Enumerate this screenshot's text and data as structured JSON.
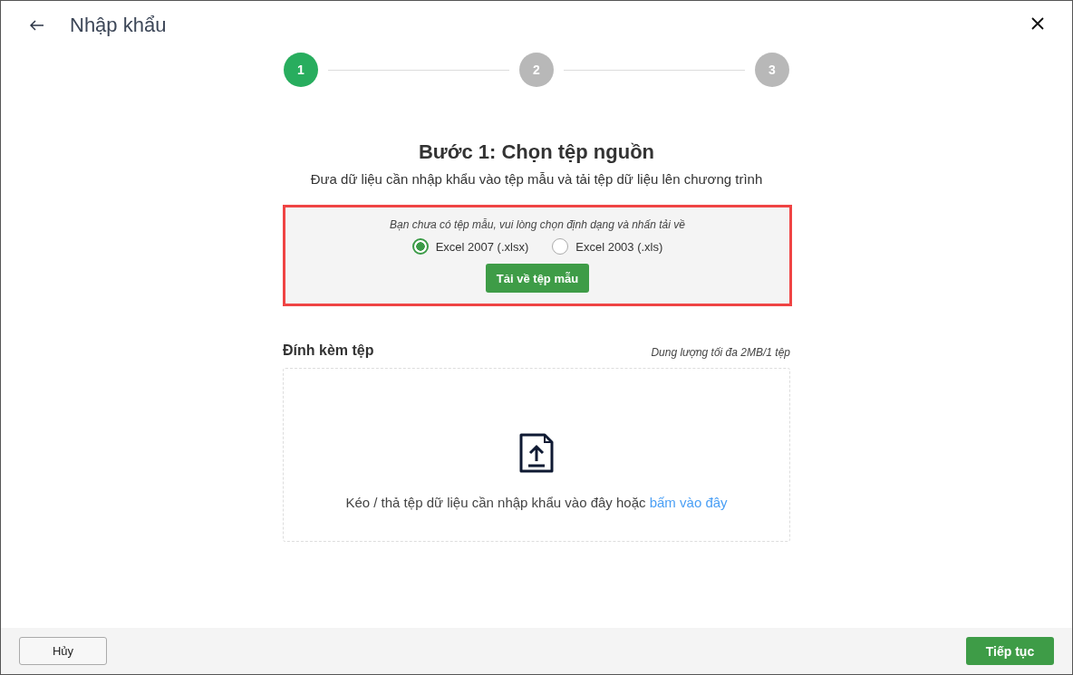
{
  "window": {
    "title": "Nhập khẩu"
  },
  "steps": [
    {
      "label": "1",
      "selected": true
    },
    {
      "label": "2",
      "selected": false
    },
    {
      "label": "3",
      "selected": false
    }
  ],
  "heading": "Bước 1: Chọn tệp nguồn",
  "subtitle": "Đưa dữ liệu cần nhập khẩu vào tệp mẫu và tải tệp dữ liệu lên chương trình",
  "template": {
    "hint": "Bạn chưa có tệp mẫu, vui lòng chọn định dạng và nhấn tải về",
    "formats": [
      {
        "label": "Excel 2007 (.xlsx)",
        "selected": true
      },
      {
        "label": "Excel 2003 (.xls)",
        "selected": false
      }
    ],
    "button": "Tải về tệp mẫu"
  },
  "attach": {
    "label": "Đính kèm tệp",
    "limit": "Dung lượng tối đa 2MB/1 tệp",
    "drop_text": "Kéo / thả tệp dữ liệu cần nhập khẩu vào đây hoặc",
    "link": "bấm vào đây"
  },
  "buttons": {
    "cancel": "Hủy",
    "next": "Tiếp tục"
  }
}
